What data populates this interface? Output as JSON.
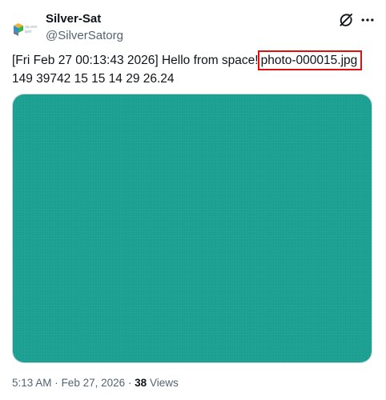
{
  "author": {
    "display_name": "Silver-Sat",
    "handle": "@SilverSatorg",
    "avatar_icon": "silversat-logo-icon",
    "avatar_text": "SILVER SAT"
  },
  "actions": {
    "grok_icon": "grok-icon",
    "more_icon": "more-horizontal-icon"
  },
  "tweet": {
    "text_line1_prefix": "[Fri Feb 27 00:13:43 2026] Hello from space!",
    "highlighted_filename": "photo-000015.jpg",
    "highlight_color": "#e01010",
    "text_line2": "149 39742 15 15 14 29 26.24"
  },
  "media": {
    "color": "#1ca394"
  },
  "meta": {
    "time": "5:13 AM",
    "separator": "·",
    "date": "Feb 27, 2026",
    "views_count": "38",
    "views_label": "Views"
  }
}
